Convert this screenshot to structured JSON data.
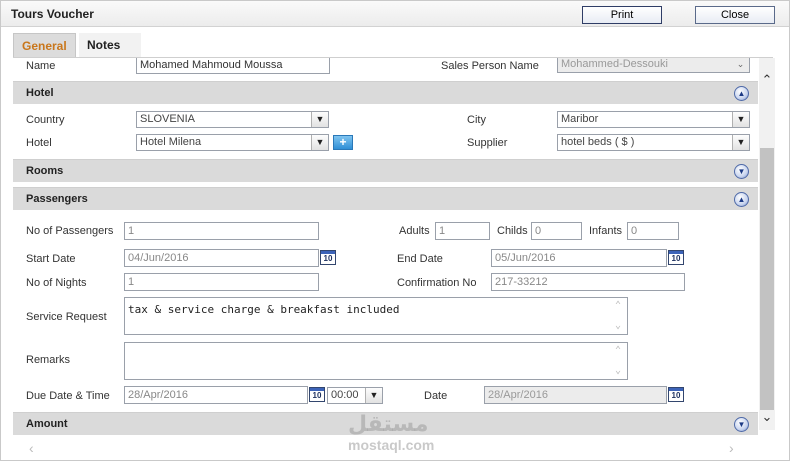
{
  "window": {
    "title": "Tours Voucher"
  },
  "toolbar": {
    "print_label": "Print",
    "close_label": "Close"
  },
  "tabs": [
    {
      "label": "General"
    },
    {
      "label": "Notes"
    }
  ],
  "top_row": {
    "name_label": "Name",
    "name_value": "Mohamed Mahmoud Moussa",
    "sales_label": "Sales Person Name",
    "sales_value": "Mohammed-Dessouki"
  },
  "hotel": {
    "title": "Hotel",
    "country_label": "Country",
    "country_value": "SLOVENIA",
    "city_label": "City",
    "city_value": "Maribor",
    "hotel_label": "Hotel",
    "hotel_value": "Hotel Milena",
    "supplier_label": "Supplier",
    "supplier_value": "hotel beds ( $ )"
  },
  "rooms": {
    "title": "Rooms"
  },
  "passengers": {
    "title": "Passengers",
    "no_of_passengers_label": "No of Passengers",
    "no_of_passengers_value": "1",
    "adults_label": "Adults",
    "adults_value": "1",
    "childs_label": "Childs",
    "childs_value": "0",
    "infants_label": "Infants",
    "infants_value": "0",
    "start_date_label": "Start Date",
    "start_date_value": "04/Jun/2016",
    "end_date_label": "End Date",
    "end_date_value": "05/Jun/2016",
    "no_of_nights_label": "No of Nights",
    "no_of_nights_value": "1",
    "confirmation_label": "Confirmation No",
    "confirmation_value": "217-33212",
    "service_request_label": "Service Request",
    "service_request_value": "tax & service charge & breakfast included",
    "remarks_label": "Remarks",
    "remarks_value": "",
    "due_label": "Due Date & Time",
    "due_date_value": "28/Apr/2016",
    "due_time_value": "00:00",
    "date_label": "Date",
    "date_value": "28/Apr/2016"
  },
  "amount": {
    "title": "Amount"
  },
  "calendar_icon_text": "10",
  "watermark": {
    "arabic": "مستقل",
    "english": "mostaql.com"
  },
  "icons": {
    "collapse": "chevron-up-circle-icon",
    "expand": "chevron-down-circle-icon",
    "dropdown": "chevron-down-icon",
    "calendar": "calendar-icon",
    "add": "plus-icon"
  }
}
